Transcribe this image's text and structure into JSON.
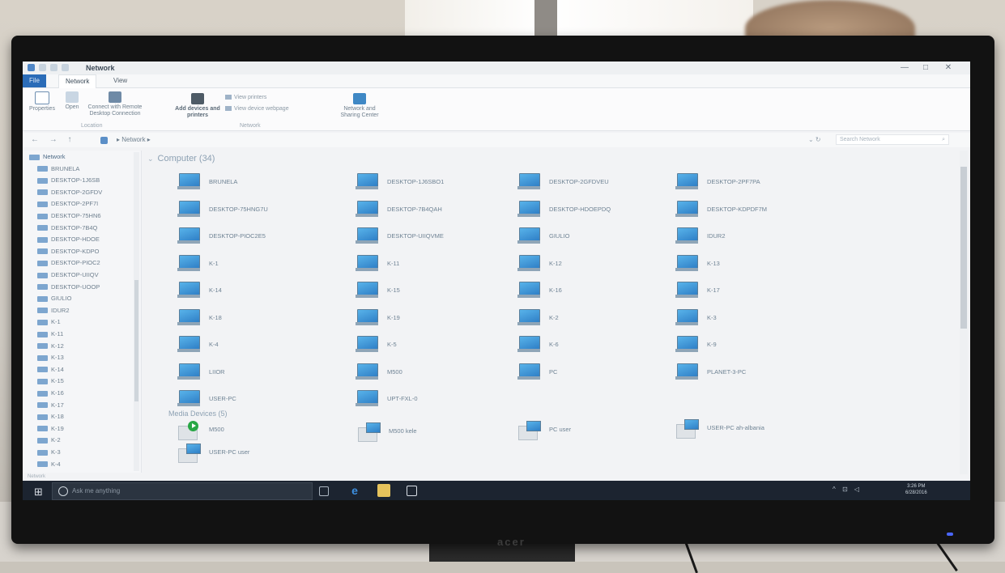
{
  "window": {
    "title": "Network",
    "tabs": [
      "File",
      "Network",
      "View"
    ],
    "minimize": "—",
    "maximize": "□",
    "close": "✕"
  },
  "ribbon": {
    "properties": "Properties",
    "open": "Open",
    "connect_remote": "Connect with Remote Desktop Connection",
    "location_group": "Location",
    "add_devices": "Add devices and printers",
    "view_printers": "View printers",
    "view_webpage": "View device webpage",
    "network_sharing": "Network and Sharing Center",
    "network_group": "Network"
  },
  "address": {
    "nav": "← → ↑",
    "breadcrumb": "▸ Network ▸",
    "refresh": "⌄ ↻",
    "search_placeholder": "Search Network",
    "search_icon": "⌕"
  },
  "navpane": {
    "items": [
      "Network",
      "BRUNELA",
      "DESKTOP-1J6SB",
      "DESKTOP-2GFDV",
      "DESKTOP-2PF7I",
      "DESKTOP-75HN6",
      "DESKTOP-7B4Q",
      "DESKTOP-HDOE",
      "DESKTOP-KDPO",
      "DESKTOP-PIOC2",
      "DESKTOP-UIIQV",
      "DESKTOP-UOOP",
      "GIULIO",
      "IDUR2",
      "K-1",
      "K-11",
      "K-12",
      "K-13",
      "K-14",
      "K-15",
      "K-16",
      "K-17",
      "K-18",
      "K-19",
      "K-2",
      "K-3",
      "K-4"
    ]
  },
  "content": {
    "computer_group": "Computer (34)",
    "computers": [
      "BRUNELA",
      "DESKTOP-1J6SBO1",
      "DESKTOP-2GFDVEU",
      "DESKTOP-2PF7PA",
      "DESKTOP-75HNG7U",
      "DESKTOP-7B4QAH",
      "DESKTOP-HDOEPDQ",
      "DESKTOP-KDPDF7M",
      "DESKTOP-PIOC2E5",
      "DESKTOP-UIIQVME",
      "GIULIO",
      "IDUR2",
      "K-1",
      "K-11",
      "K-12",
      "K-13",
      "K-14",
      "K-15",
      "K-16",
      "K-17",
      "K-18",
      "K-19",
      "K-2",
      "K-3",
      "K-4",
      "K-5",
      "K-6",
      "K-9",
      "LIIOR",
      "M500",
      "PC",
      "PLANET-3-PC",
      "USER-PC",
      "UPT-FXL-0"
    ],
    "media_group": "Media Devices (5)",
    "media": [
      "M500",
      "M500 kele",
      "PC user",
      "USER-PC ah-albania",
      "USER-PC user"
    ]
  },
  "status": {
    "items": "Network"
  },
  "taskbar": {
    "start": "⊞",
    "cortana": "Ask me anything",
    "time": "3:26 PM",
    "date": "6/28/2016",
    "tray": "^ ⊡ ◁"
  },
  "monitor": {
    "brand": "acer"
  }
}
